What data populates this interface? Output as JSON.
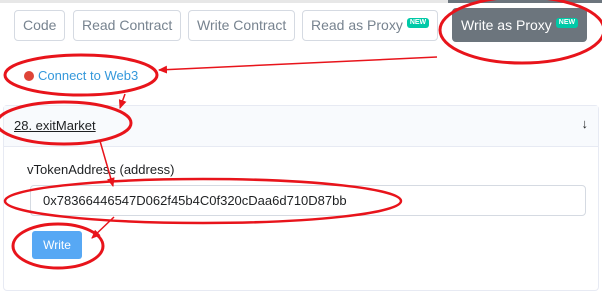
{
  "tabs": [
    {
      "label": "Code"
    },
    {
      "label": "Read Contract"
    },
    {
      "label": "Write Contract"
    },
    {
      "label": "Read as Proxy",
      "badge": "NEW"
    },
    {
      "label": "Write as Proxy",
      "badge": "NEW",
      "active": true
    }
  ],
  "connect": {
    "label": "Connect to Web3",
    "status_color": "#de4437"
  },
  "method": {
    "title": "28. exitMarket",
    "param_label": "vTokenAddress (address)",
    "input_value": "0x78366446547D062f45b4C0f320cDaa6d710D87bb",
    "write_label": "Write"
  },
  "colors": {
    "annotation_red": "#e8141b",
    "link_blue": "#3498db",
    "badge_green": "#00c9a7",
    "button_blue": "#57a8f4"
  },
  "icons": {
    "collapse": "arrow-down-icon",
    "status": "red-dot-icon"
  }
}
